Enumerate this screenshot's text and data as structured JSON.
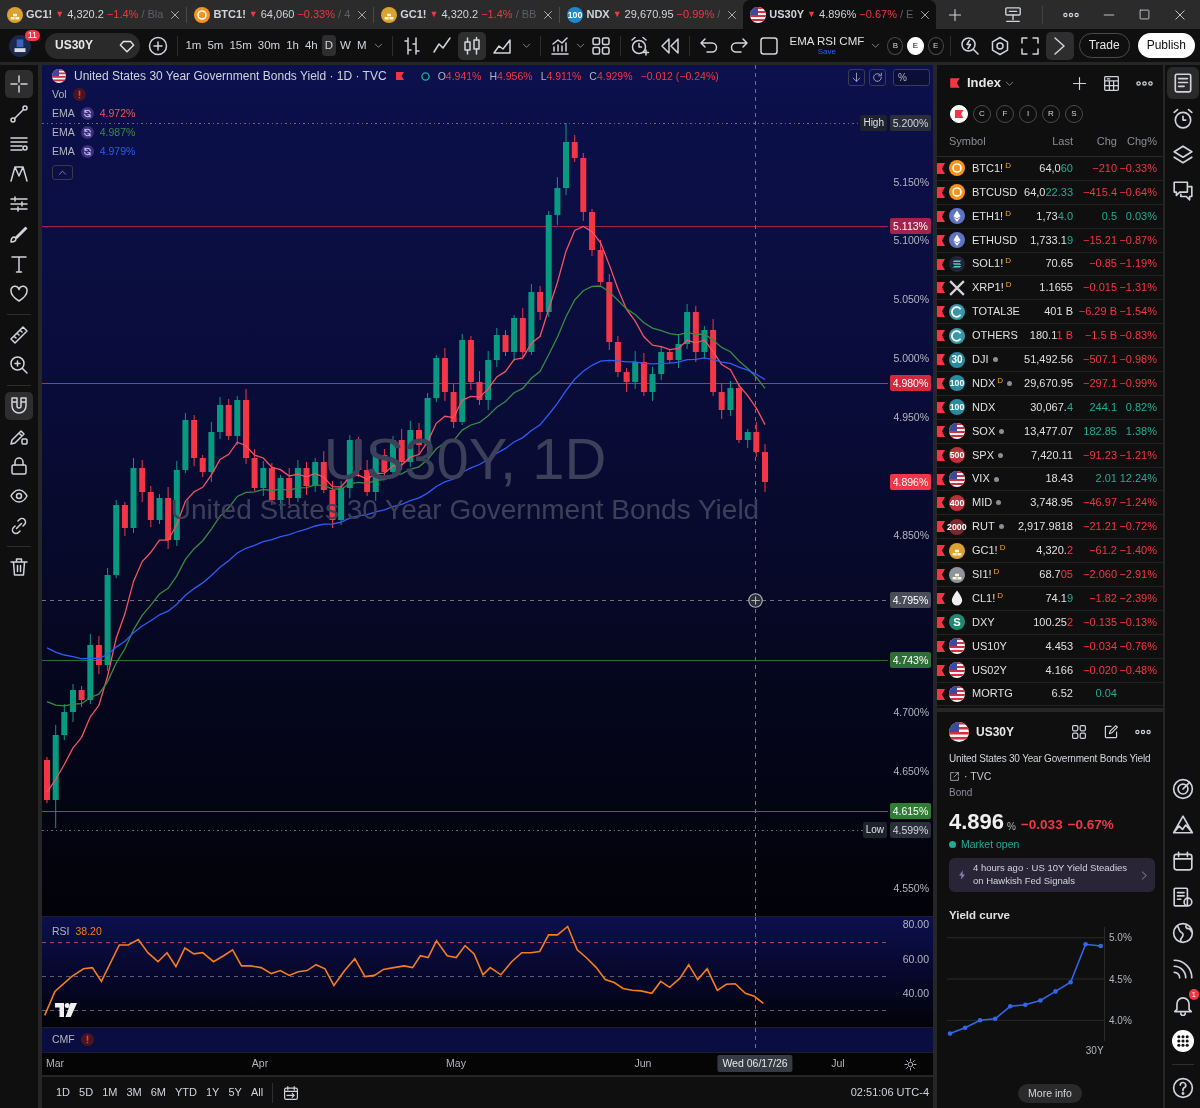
{
  "browser_tabs": [
    {
      "logo": {
        "kind": "gold"
      },
      "symbol": "GC1!",
      "trend_mark": "▼",
      "price": "4,320.2",
      "change": "−1.4%",
      "note": "/ Bla",
      "selected": false
    },
    {
      "logo": {
        "kind": "coin"
      },
      "symbol": "BTC1!",
      "trend_mark": "▼",
      "price": "64,060",
      "change": "−0.33%",
      "note": "/ 4",
      "selected": false
    },
    {
      "logo": {
        "kind": "gold"
      },
      "symbol": "GC1!",
      "trend_mark": "▼",
      "price": "4,320.2",
      "change": "−1.4%",
      "note": "/ BB",
      "selected": false
    },
    {
      "logo": {
        "kind": "badge",
        "text": "100",
        "color": "#1e88c8"
      },
      "symbol": "NDX",
      "trend_mark": "▼",
      "price": "29,670.95",
      "change": "−0.99%",
      "note": "/",
      "selected": false
    },
    {
      "logo": {
        "kind": "us-flag"
      },
      "symbol": "US30Y",
      "trend_mark": "▼",
      "price": "4.896%",
      "change": "−0.67%",
      "note": "/ E",
      "selected": true
    }
  ],
  "toolbar": {
    "avatar_badge": "11",
    "symbol": "US30Y",
    "intervals": [
      {
        "label": "1m",
        "selected": false
      },
      {
        "label": "5m",
        "selected": false
      },
      {
        "label": "15m",
        "selected": false
      },
      {
        "label": "30m",
        "selected": false
      },
      {
        "label": "1h",
        "selected": false
      },
      {
        "label": "4h",
        "selected": false
      },
      {
        "label": "D",
        "selected": true
      },
      {
        "label": "W",
        "selected": false
      },
      {
        "label": "M",
        "selected": false
      }
    ],
    "chart_types": [
      {
        "kind": "bars",
        "selected": false
      },
      {
        "kind": "line",
        "selected": false
      },
      {
        "kind": "candles",
        "selected": true
      },
      {
        "kind": "area",
        "selected": false
      }
    ],
    "layout_name": "EMA RSI CMF",
    "layout_status": "Save",
    "quick_buttons": [
      {
        "label": "B",
        "selected": false
      },
      {
        "label": "E",
        "selected": true
      },
      {
        "label": "E",
        "selected": false
      }
    ],
    "trade": "Trade",
    "publish": "Publish"
  },
  "drawing_tools": [
    {
      "kind": "crosshair",
      "selected": true
    },
    {
      "kind": "trend-line",
      "selected": false
    },
    {
      "kind": "fib",
      "selected": false
    },
    {
      "kind": "pattern",
      "selected": false
    },
    {
      "kind": "projection",
      "selected": false
    },
    {
      "kind": "brush",
      "selected": false
    },
    {
      "kind": "text",
      "selected": false
    },
    {
      "kind": "heart",
      "selected": false
    },
    {
      "kind": "ruler",
      "selected": false
    },
    {
      "kind": "zoom",
      "selected": false
    },
    {
      "kind": "magnet",
      "selected": true
    },
    {
      "kind": "pencil-lock",
      "selected": false
    },
    {
      "kind": "lock",
      "selected": false
    },
    {
      "kind": "eye",
      "selected": false
    },
    {
      "kind": "link",
      "selected": false
    },
    {
      "kind": "trash",
      "selected": false
    }
  ],
  "chart": {
    "logo": {
      "kind": "us-flag"
    },
    "title": "United States 30 Year Government Bonds Yield · 1D · TVC",
    "ohlc": [
      {
        "key": "O",
        "value": "4.941%"
      },
      {
        "key": "H",
        "value": "4.956%"
      },
      {
        "key": "L",
        "value": "4.911%"
      },
      {
        "key": "C",
        "value": "4.929%"
      }
    ],
    "change": "−0.012 (−0.24%)",
    "falling": true,
    "indicators": [
      {
        "kind": "error",
        "name": "Vol"
      },
      {
        "kind": "ema",
        "name": "EMA",
        "value": "4.972%",
        "color": "#f7525f"
      },
      {
        "kind": "ema",
        "name": "EMA",
        "value": "4.987%",
        "color": "#3a8a45"
      },
      {
        "kind": "ema",
        "name": "EMA",
        "value": "4.979%",
        "color": "#2f5cf5"
      }
    ],
    "watermark": {
      "title": "US30Y, 1D",
      "subtitle": "United States 30 Year Government Bonds Yield"
    },
    "scale_button": "%",
    "price_ticks": [
      "5.150%",
      "5.100%",
      "5.050%",
      "5.000%",
      "4.950%",
      "4.850%",
      "4.700%",
      "4.650%",
      "4.550%"
    ],
    "markers": [
      {
        "kind": "high",
        "caption": "High",
        "value": "5.200%"
      },
      {
        "kind": "level",
        "value": "5.113%",
        "color": "#a3244a"
      },
      {
        "kind": "level",
        "value": "4.980%",
        "color": "#d3293d"
      },
      {
        "kind": "last",
        "value": "4.896%",
        "color": "#f23645"
      },
      {
        "kind": "crosshair",
        "value": "4.795%"
      },
      {
        "kind": "level",
        "value": "4.743%",
        "color": "#2c6e35"
      },
      {
        "kind": "level",
        "value": "4.615%",
        "color": "#2e7d32"
      },
      {
        "kind": "low",
        "caption": "Low",
        "value": "4.599%"
      }
    ],
    "time_labels": [
      "Mar",
      "Apr",
      "May",
      "Jun",
      "Jul"
    ],
    "cursor_time": "Wed 06/17/26"
  },
  "rsi": {
    "name": "RSI",
    "value": "38.20",
    "ticks": [
      "80.00",
      "60.00",
      "40.00"
    ]
  },
  "cmf": {
    "name": "CMF",
    "error": true
  },
  "range_bar": {
    "ranges": [
      "1D",
      "5D",
      "1M",
      "3M",
      "6M",
      "YTD",
      "1Y",
      "5Y",
      "All"
    ],
    "clock": "02:51:06 UTC-4"
  },
  "watchlist": {
    "title": "Index",
    "filters": [
      {
        "kind": "flag",
        "selected": true
      },
      {
        "kind": "letter",
        "label": "C",
        "selected": false
      },
      {
        "kind": "letter",
        "label": "F",
        "selected": false
      },
      {
        "kind": "letter",
        "label": "I",
        "selected": false
      },
      {
        "kind": "letter",
        "label": "R",
        "selected": false
      },
      {
        "kind": "letter",
        "label": "S",
        "selected": false
      }
    ],
    "columns": [
      "Symbol",
      "Last",
      "Chg",
      "Chg%"
    ],
    "rows": [
      {
        "flagged": true,
        "logo": {
          "kind": "coin"
        },
        "symbol": "BTC1!",
        "suffix": "D",
        "dot": false,
        "last": "64,0",
        "last_tick": "60",
        "tick_up": true,
        "change": "−210",
        "change_pct": "−0.33%",
        "falling": true
      },
      {
        "flagged": true,
        "logo": {
          "kind": "coin"
        },
        "symbol": "BTCUSD",
        "dot": false,
        "last": "64,0",
        "last_tick": "22.33",
        "tick_up": true,
        "change": "−415.4",
        "change_pct": "−0.64%",
        "falling": true
      },
      {
        "flagged": true,
        "logo": {
          "kind": "eth"
        },
        "symbol": "ETH1!",
        "suffix": "D",
        "dot": false,
        "last": "1,73",
        "last_tick": "4.0",
        "tick_up": true,
        "change": "0.5",
        "change_pct": "0.03%",
        "falling": false
      },
      {
        "flagged": true,
        "logo": {
          "kind": "eth"
        },
        "symbol": "ETHUSD",
        "dot": false,
        "last": "1,733.1",
        "last_tick": "9",
        "tick_up": true,
        "change": "−15.21",
        "change_pct": "−0.87%",
        "falling": true
      },
      {
        "flagged": true,
        "logo": {
          "kind": "sol"
        },
        "symbol": "SOL1!",
        "suffix": "D",
        "dot": false,
        "last": "70.65",
        "change": "−0.85",
        "change_pct": "−1.19%",
        "falling": true
      },
      {
        "flagged": true,
        "logo": {
          "kind": "x"
        },
        "symbol": "XRP1!",
        "suffix": "D",
        "dot": false,
        "last": "1.1655",
        "change": "−0.015",
        "change_pct": "−1.31%",
        "falling": true
      },
      {
        "flagged": true,
        "logo": {
          "kind": "ring"
        },
        "symbol": "TOTAL3E",
        "dot": false,
        "last": "401 B",
        "change": "−6.29 B",
        "change_pct": "−1.54%",
        "falling": true
      },
      {
        "flagged": true,
        "logo": {
          "kind": "ring"
        },
        "symbol": "OTHERS",
        "dot": false,
        "last": "180.1",
        "last_tick": "1 B",
        "tick_up": false,
        "change": "−1.5 B",
        "change_pct": "−0.83%",
        "falling": true
      },
      {
        "flagged": true,
        "logo": {
          "kind": "badge",
          "text": "30",
          "color": "#2a8aa0"
        },
        "symbol": "DJI",
        "dot": true,
        "last": "51,492.56",
        "change": "−507.1",
        "change_pct": "−0.98%",
        "falling": true
      },
      {
        "flagged": true,
        "logo": {
          "kind": "badge",
          "text": "100",
          "color": "#2a8aa0"
        },
        "symbol": "NDX",
        "suffix": "D",
        "dot": true,
        "last": "29,670.95",
        "change": "−297.1",
        "change_pct": "−0.99%",
        "falling": true
      },
      {
        "flagged": true,
        "logo": {
          "kind": "badge",
          "text": "100",
          "color": "#2a8aa0"
        },
        "symbol": "NDX",
        "dot": false,
        "last": "30,067.",
        "last_tick": "4",
        "tick_up": true,
        "change": "244.1",
        "change_pct": "0.82%",
        "falling": false
      },
      {
        "flagged": true,
        "logo": {
          "kind": "us-flag"
        },
        "symbol": "SOX",
        "dot": true,
        "last": "13,477.07",
        "change": "182.85",
        "change_pct": "1.38%",
        "falling": false
      },
      {
        "flagged": true,
        "logo": {
          "kind": "badge",
          "text": "500",
          "color": "#b8333a"
        },
        "symbol": "SPX",
        "dot": true,
        "last": "7,420.11",
        "change": "−91.23",
        "change_pct": "−1.21%",
        "falling": true
      },
      {
        "flagged": true,
        "logo": {
          "kind": "us-flag"
        },
        "symbol": "VIX",
        "dot": true,
        "last": "18.43",
        "change": "2.01",
        "change_pct": "12.24%",
        "falling": false
      },
      {
        "flagged": true,
        "logo": {
          "kind": "badge",
          "text": "400",
          "color": "#b8333a"
        },
        "symbol": "MID",
        "dot": true,
        "last": "3,748.95",
        "change": "−46.97",
        "change_pct": "−1.24%",
        "falling": true
      },
      {
        "flagged": true,
        "logo": {
          "kind": "badge",
          "text": "2000",
          "color": "#7a2a2e"
        },
        "symbol": "RUT",
        "dot": true,
        "last": "2,917.9818",
        "change": "−21.21",
        "change_pct": "−0.72%",
        "falling": true
      },
      {
        "flagged": true,
        "logo": {
          "kind": "gold"
        },
        "symbol": "GC1!",
        "suffix": "D",
        "dot": false,
        "last": "4,320.",
        "last_tick": "2",
        "tick_up": false,
        "change": "−61.2",
        "change_pct": "−1.40%",
        "falling": true
      },
      {
        "flagged": true,
        "logo": {
          "kind": "silver"
        },
        "symbol": "SI1!",
        "suffix": "D",
        "dot": false,
        "last": "68.7",
        "last_tick": "05",
        "tick_up": false,
        "change": "−2.060",
        "change_pct": "−2.91%",
        "falling": true
      },
      {
        "flagged": true,
        "logo": {
          "kind": "drop"
        },
        "symbol": "CL1!",
        "suffix": "D",
        "dot": false,
        "last": "74.1",
        "last_tick": "9",
        "tick_up": true,
        "change": "−1.82",
        "change_pct": "−2.39%",
        "falling": true
      },
      {
        "flagged": true,
        "logo": {
          "kind": "badge",
          "text": "S",
          "color": "#1f8a70"
        },
        "symbol": "DXY",
        "dot": false,
        "last": "100.25",
        "last_tick": "2",
        "tick_up": false,
        "change": "−0.135",
        "change_pct": "−0.13%",
        "falling": true
      },
      {
        "flagged": true,
        "logo": {
          "kind": "us-flag"
        },
        "symbol": "US10Y",
        "dot": false,
        "last": "4.453",
        "change": "−0.034",
        "change_pct": "−0.76%",
        "falling": true
      },
      {
        "flagged": true,
        "logo": {
          "kind": "us-flag"
        },
        "symbol": "US02Y",
        "dot": false,
        "last": "4.166",
        "change": "−0.020",
        "change_pct": "−0.48%",
        "falling": true
      },
      {
        "flagged": true,
        "logo": {
          "kind": "us-flag"
        },
        "symbol": "MORTG",
        "dot": false,
        "last": "6.52",
        "change": "0.04",
        "falling": false
      }
    ]
  },
  "details": {
    "logo": {
      "kind": "us-flag"
    },
    "symbol": "US30Y",
    "name": "United States 30 Year Government Bonds Yield",
    "source": "· TVC",
    "type": "Bond",
    "price": "4.896",
    "unit": "%",
    "change": "−0.033",
    "change_pct": "−0.67%",
    "falling": true,
    "status": "Market open",
    "market_open": true,
    "news": "4 hours ago · US 10Y Yield Steadies on Hawkish Fed Signals",
    "chart_data": {
      "type": "line",
      "title": "Yield curve",
      "grid": true,
      "ylim": [
        3.75,
        5.13
      ],
      "yticks": [
        {
          "value": 4.0,
          "label": "4.0%"
        },
        {
          "value": 4.5,
          "label": "4.5%"
        },
        {
          "value": 5.0,
          "label": "5.0%"
        }
      ],
      "series": [
        {
          "color": "#3366ee",
          "values": [
            3.84,
            3.91,
            4.0,
            4.02,
            4.17,
            4.19,
            4.24,
            4.35,
            4.46,
            4.92,
            4.9
          ]
        }
      ],
      "annotations": [
        "30Y"
      ]
    },
    "more_button": "More info"
  },
  "side_strip": {
    "top": [
      {
        "kind": "watchlist",
        "selected": true
      },
      {
        "kind": "alerts",
        "selected": false
      },
      {
        "kind": "layers",
        "selected": false
      },
      {
        "kind": "chat",
        "selected": false
      }
    ],
    "bottom": [
      {
        "kind": "target"
      },
      {
        "kind": "ideas"
      },
      {
        "kind": "calendar"
      },
      {
        "kind": "report"
      },
      {
        "kind": "globe"
      },
      {
        "kind": "signal"
      },
      {
        "kind": "bell",
        "badge": "1"
      },
      {
        "kind": "apps"
      },
      {
        "kind": "help"
      }
    ]
  }
}
